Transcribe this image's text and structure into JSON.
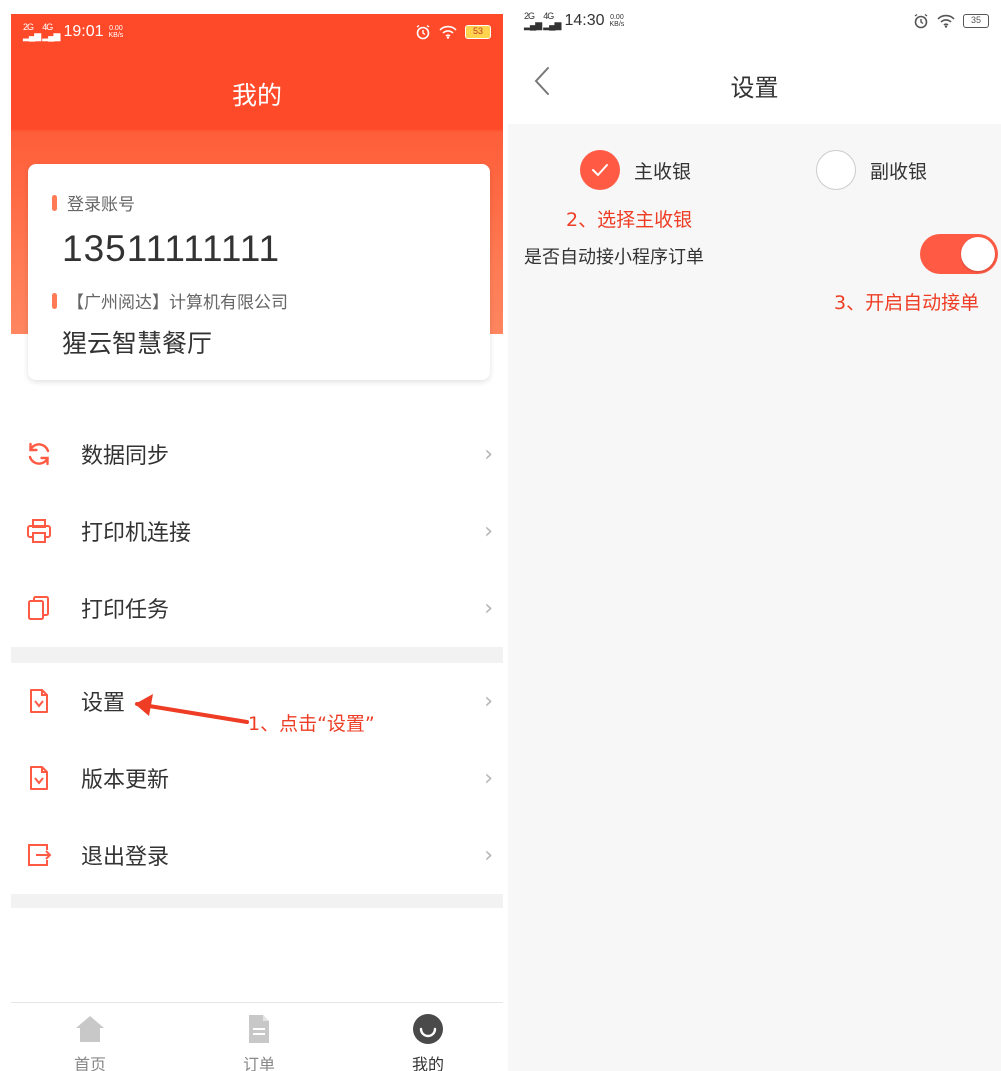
{
  "left_screen": {
    "status_bar": {
      "sig1": "2G",
      "sig2": "4G",
      "time": "19:01",
      "net_speed": "0.00",
      "net_unit": "KB/s",
      "battery": "53"
    },
    "title": "我的",
    "account_card": {
      "account_label": "登录账号",
      "account_number": "13511111111",
      "company": "【广州阅达】计算机有限公司",
      "shop_name": "猩云智慧餐厅"
    },
    "menu": [
      {
        "label": "数据同步",
        "icon": "sync-icon"
      },
      {
        "label": "打印机连接",
        "icon": "printer-icon"
      },
      {
        "label": "打印任务",
        "icon": "print-task-icon"
      },
      {
        "label": "设置",
        "icon": "settings-doc-icon"
      },
      {
        "label": "版本更新",
        "icon": "update-doc-icon"
      },
      {
        "label": "退出登录",
        "icon": "logout-icon"
      }
    ],
    "chevron": "›",
    "annotation_1": "1、点击“设置”",
    "tabs": [
      {
        "label": "首页",
        "icon": "home-icon",
        "active": false
      },
      {
        "label": "订单",
        "icon": "order-doc-icon",
        "active": false
      },
      {
        "label": "我的",
        "icon": "smile-icon",
        "active": true
      }
    ]
  },
  "right_screen": {
    "status_bar": {
      "sig1": "2G",
      "sig2": "4G",
      "time": "14:30",
      "net_speed": "0.00",
      "net_unit": "KB/s",
      "battery": "35"
    },
    "title": "设置",
    "back_icon": "chevron-left-icon",
    "radio_options": [
      {
        "label": "主收银",
        "selected": true
      },
      {
        "label": "副收银",
        "selected": false
      }
    ],
    "annotation_2": "2、选择主收银",
    "auto_accept_label": "是否自动接小程序订单",
    "auto_accept_on": true,
    "annotation_3": "3、开启自动接单"
  },
  "colors": {
    "brand_red": "#ff4a2a",
    "accent": "#ff5a44",
    "annotation": "#ee3d24",
    "text": "#333333",
    "muted": "#888888"
  }
}
